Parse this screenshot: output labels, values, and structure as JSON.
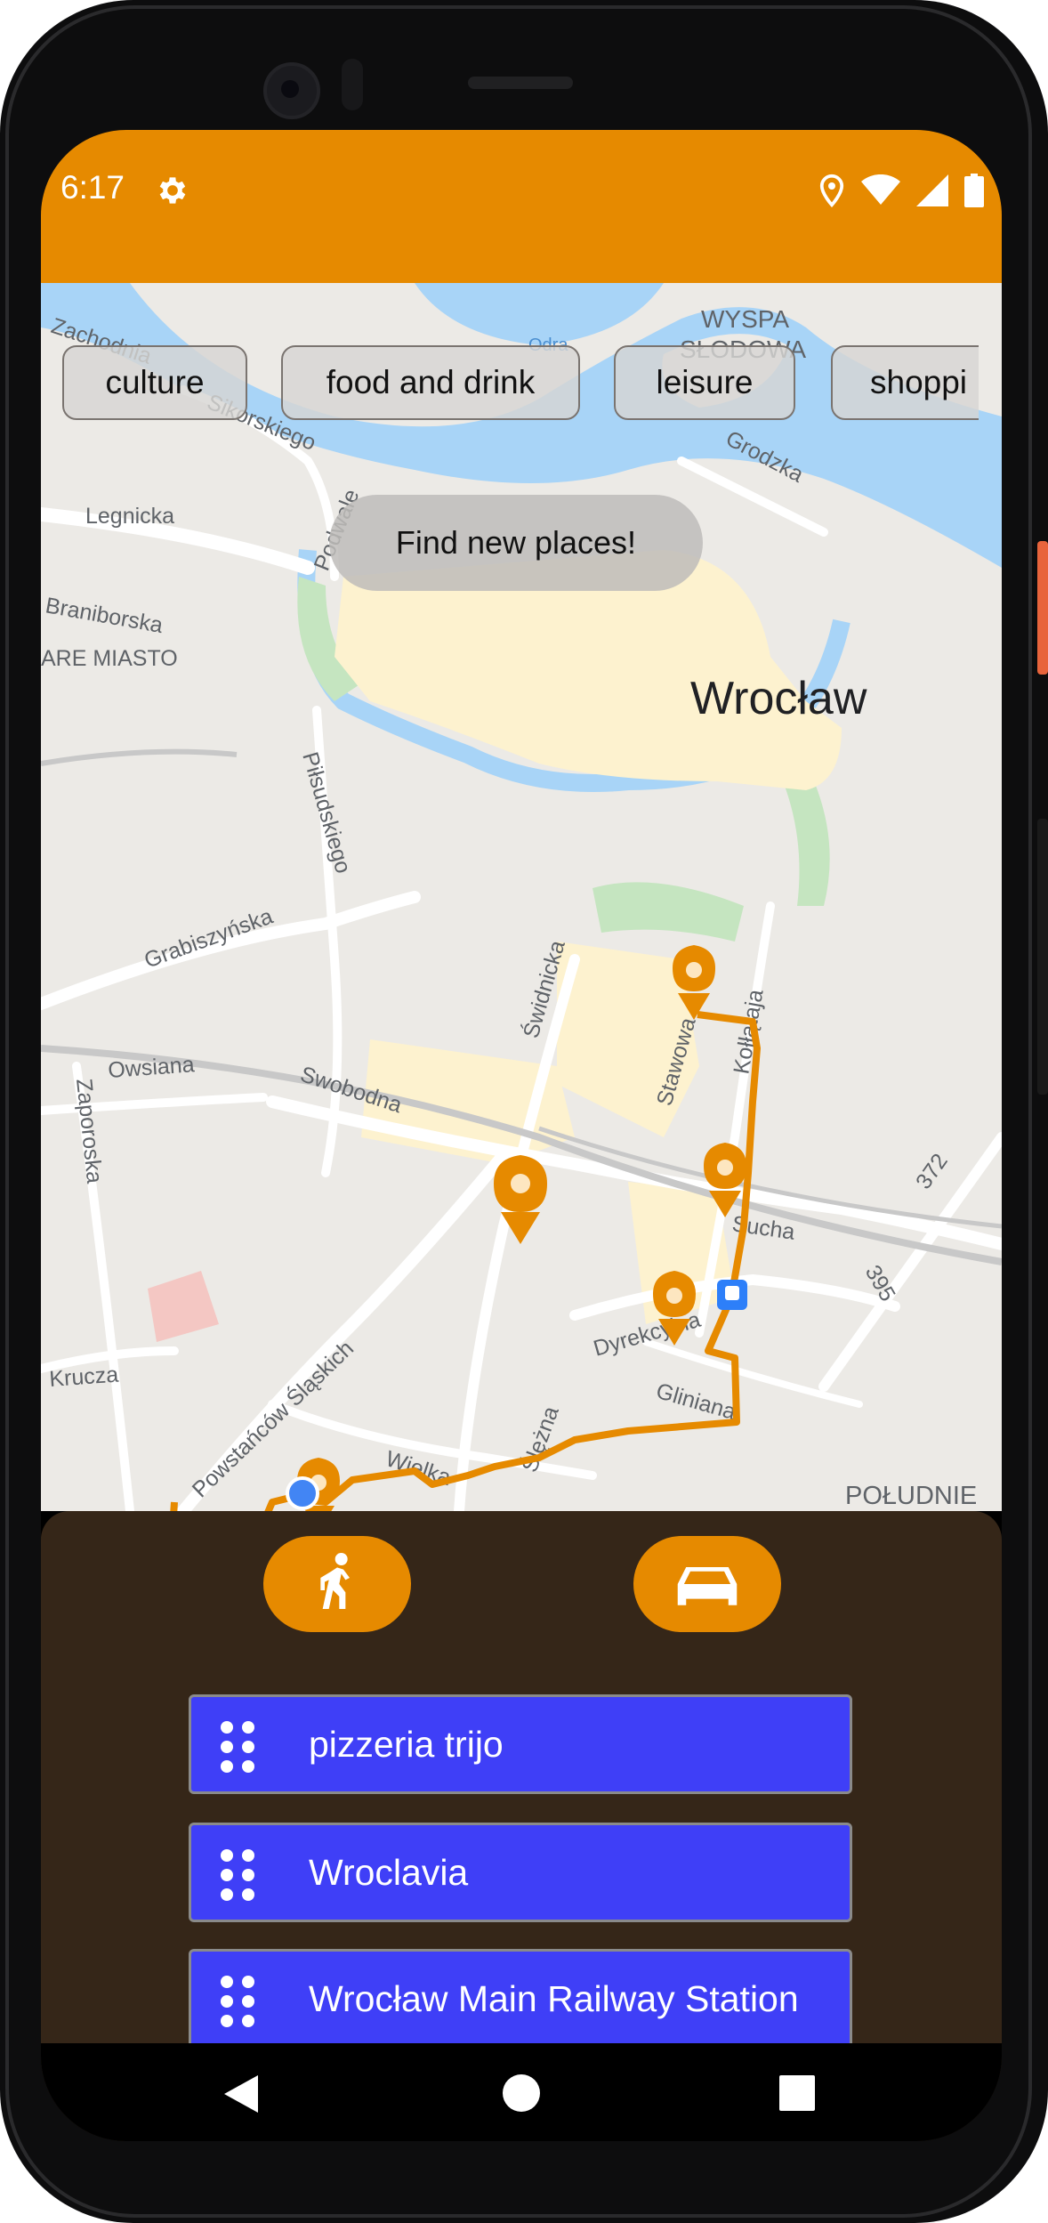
{
  "status_bar": {
    "time": "6:17",
    "icons": [
      "gear-icon",
      "location-icon",
      "wifi-icon",
      "signal-icon",
      "battery-icon"
    ],
    "color": "#e68a00"
  },
  "categories": [
    "culture",
    "food and drink",
    "leisure",
    "shoppi"
  ],
  "find_button": "Find new places!",
  "map": {
    "labels": {
      "zachodnia": "Zachodnia",
      "odra": "Odra",
      "wyspa": "WYSPA",
      "slodowa": "SŁODOWA",
      "sikorskiego": "Sikorskiego",
      "grodzka": "Grodzka",
      "legnicka": "Legnicka",
      "podwale": "Podwale",
      "braniborska": "Braniborska",
      "stare_miasto": "ARE MIASTO",
      "wroclaw": "Wrocław",
      "pilsudskiego": "Piłsudskiego",
      "grabiszynska": "Grabiszyńska",
      "swidnicka": "Świdnicka",
      "kollataja": "Kołłątaja",
      "stawowa": "Stawowa",
      "owsiana": "Owsiana",
      "swobodna": "Swobodna",
      "zaporoska": "Zaporoska",
      "road_372": "372",
      "sucha": "Sucha",
      "road_395": "395",
      "dyrekcyjna": "Dyrekcyjna",
      "krucza": "Krucza",
      "powstancow": "Powstańców Śląskich",
      "glinana": "Gliniana",
      "slezna": "Ślężna",
      "wielka": "Wielka",
      "poludnie": "POŁUDNIE"
    },
    "route_color": "#e68a00"
  },
  "travel_modes": [
    "walk-icon",
    "car-icon"
  ],
  "places": [
    "pizzeria trijo",
    "Wroclavia",
    "Wrocław Main Railway Station"
  ],
  "nav": [
    "back-icon",
    "home-icon",
    "recents-icon"
  ]
}
